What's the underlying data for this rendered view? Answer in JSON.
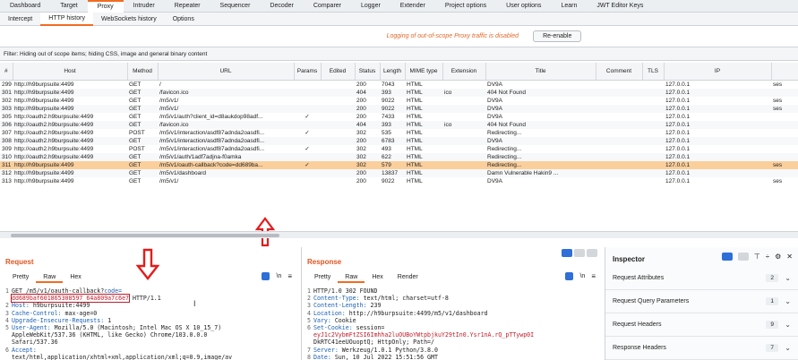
{
  "main_tabs": [
    "Dashboard",
    "Target",
    "Proxy",
    "Intruder",
    "Repeater",
    "Sequencer",
    "Decoder",
    "Comparer",
    "Logger",
    "Extender",
    "Project options",
    "User options",
    "Learn",
    "JWT Editor Keys"
  ],
  "main_active": 2,
  "sub_tabs": [
    "Intercept",
    "HTTP history",
    "WebSockets history",
    "Options"
  ],
  "sub_active": 1,
  "log_message": "Logging of out-of-scope Proxy traffic is disabled",
  "reenable_label": "Re-enable",
  "filter_text": "Filter: Hiding out of scope items;  hiding CSS, image and general binary content",
  "columns": [
    "#",
    "Host",
    "Method",
    "URL",
    "Params",
    "Edited",
    "Status",
    "Length",
    "MIME type",
    "Extension",
    "Title",
    "Comment",
    "TLS",
    "IP",
    ""
  ],
  "rows": [
    [
      "299",
      "http://h9burpsuite:4499",
      "GET",
      "/",
      "",
      "",
      "200",
      "7043",
      "HTML",
      "",
      "DV9A",
      "",
      "",
      "127.0.0.1",
      "ses"
    ],
    [
      "301",
      "http://h9burpsuite:4499",
      "GET",
      "/favicon.ico",
      "",
      "",
      "404",
      "393",
      "HTML",
      "ico",
      "404 Not Found",
      "",
      "",
      "127.0.0.1",
      ""
    ],
    [
      "302",
      "http://h9burpsuite:4499",
      "GET",
      "/m5/v1/",
      "",
      "",
      "200",
      "9022",
      "HTML",
      "",
      "DV9A",
      "",
      "",
      "127.0.0.1",
      "ses"
    ],
    [
      "303",
      "http://h9burpsuite:4499",
      "GET",
      "/m5/v1/",
      "",
      "",
      "200",
      "9022",
      "HTML",
      "",
      "DV9A",
      "",
      "",
      "127.0.0.1",
      "ses"
    ],
    [
      "305",
      "http://oauth2.h9burpsuite:4499",
      "GET",
      "/m5/v1/auth?client_id=d8aukdop98adf...",
      "✓",
      "",
      "200",
      "7433",
      "HTML",
      "",
      "DV9A",
      "",
      "",
      "127.0.0.1",
      ""
    ],
    [
      "306",
      "http://oauth2.h9burpsuite:4499",
      "GET",
      "/favicon.ico",
      "",
      "",
      "404",
      "393",
      "HTML",
      "ico",
      "404 Not Found",
      "",
      "",
      "127.0.0.1",
      ""
    ],
    [
      "307",
      "http://oauth2.h9burpsuite:4499",
      "POST",
      "/m5/v1/interaction/asdf87adnda2oasdfi...",
      "✓",
      "",
      "302",
      "535",
      "HTML",
      "",
      "Redirecting...",
      "",
      "",
      "127.0.0.1",
      ""
    ],
    [
      "308",
      "http://oauth2.h9burpsuite:4499",
      "GET",
      "/m5/v1/interaction/asdf87adnda2oasdfi...",
      "",
      "",
      "200",
      "6783",
      "HTML",
      "",
      "DV9A",
      "",
      "",
      "127.0.0.1",
      ""
    ],
    [
      "309",
      "http://oauth2.h9burpsuite:4499",
      "POST",
      "/m5/v1/interaction/asdf87adnda2oasdfi...",
      "✓",
      "",
      "302",
      "493",
      "HTML",
      "",
      "Redirecting...",
      "",
      "",
      "127.0.0.1",
      ""
    ],
    [
      "310",
      "http://oauth2.h9burpsuite:4499",
      "GET",
      "/m5/v1/auth/1adf7adjna-f0amka",
      "",
      "",
      "302",
      "622",
      "HTML",
      "",
      "Redirecting...",
      "",
      "",
      "127.0.0.1",
      ""
    ],
    [
      "311",
      "http://h9burpsuite:4499",
      "GET",
      "/m5/v1/oauth-callback?code=dd689ba...",
      "✓",
      "",
      "302",
      "579",
      "HTML",
      "",
      "Redirecting...",
      "",
      "",
      "127.0.0.1",
      "ses"
    ],
    [
      "312",
      "http://h9burpsuite:4499",
      "GET",
      "/m5/v1/dashboard",
      "",
      "",
      "200",
      "13837",
      "HTML",
      "",
      "Damn Vulnerable Hakin9 ...",
      "",
      "",
      "127.0.0.1",
      ""
    ],
    [
      "313",
      "http://h9burpsuite:4499",
      "GET",
      "/m5/v1/",
      "",
      "",
      "200",
      "9022",
      "HTML",
      "",
      "DV9A",
      "",
      "",
      "127.0.0.1",
      "ses"
    ]
  ],
  "selected_row": 10,
  "request": {
    "title": "Request",
    "tabs": [
      "Pretty",
      "Raw",
      "Hex"
    ],
    "active_tab": 1,
    "lines": [
      {
        "n": "1",
        "parts": [
          [
            "GET /m5/v1/oauth-callback?",
            ""
          ],
          [
            "code=",
            "kw"
          ]
        ]
      },
      {
        "n": "",
        "parts": [
          [
            "dd689baf601865308597 64a809a7c6e7",
            "hl"
          ],
          [
            " HTTP/1.1",
            ""
          ]
        ]
      },
      {
        "n": "2",
        "parts": [
          [
            "Host: ",
            "kw"
          ],
          [
            "h9burpsuite:4499",
            ""
          ]
        ]
      },
      {
        "n": "3",
        "parts": [
          [
            "Cache-Control: ",
            "kw"
          ],
          [
            "max-age=0",
            ""
          ]
        ]
      },
      {
        "n": "4",
        "parts": [
          [
            "Upgrade-Insecure-Requests: ",
            "kw"
          ],
          [
            "1",
            ""
          ]
        ]
      },
      {
        "n": "5",
        "parts": [
          [
            "User-Agent: ",
            "kw"
          ],
          [
            "Mozilla/5.0 (Macintosh; Intel Mac OS X 10_15_7)",
            ""
          ]
        ]
      },
      {
        "n": "",
        "parts": [
          [
            "AppleWebKit/537.36 (KHTML, like Gecko) Chrome/103.0.0.0",
            ""
          ]
        ]
      },
      {
        "n": "",
        "parts": [
          [
            "Safari/537.36",
            ""
          ]
        ]
      },
      {
        "n": "6",
        "parts": [
          [
            "Accept: ",
            "kw"
          ]
        ]
      },
      {
        "n": "",
        "parts": [
          [
            "text/html,application/xhtml+xml,application/xml;q=0.9,image/av",
            ""
          ]
        ]
      },
      {
        "n": "",
        "parts": [
          [
            "if,image/webp,image/apng,*/*;q=0.8,application/signed-exchange",
            ""
          ]
        ]
      }
    ]
  },
  "response": {
    "title": "Response",
    "tabs": [
      "Pretty",
      "Raw",
      "Hex",
      "Render"
    ],
    "active_tab": 1,
    "lines": [
      {
        "n": "1",
        "parts": [
          [
            "HTTP/1.0 302 FOUND",
            ""
          ]
        ]
      },
      {
        "n": "2",
        "parts": [
          [
            "Content-Type: ",
            "kw"
          ],
          [
            "text/html; charset=utf-8",
            ""
          ]
        ]
      },
      {
        "n": "3",
        "parts": [
          [
            "Content-Length: ",
            "kw"
          ],
          [
            "239",
            ""
          ]
        ]
      },
      {
        "n": "4",
        "parts": [
          [
            "Location: ",
            "kw"
          ],
          [
            "http://h9burpsuite:4499/m5/v1/dashboard",
            ""
          ]
        ]
      },
      {
        "n": "5",
        "parts": [
          [
            "Vary: ",
            "kw"
          ],
          [
            "Cookie",
            ""
          ]
        ]
      },
      {
        "n": "6",
        "parts": [
          [
            "Set-Cookie: ",
            "kw"
          ],
          [
            "session=",
            ""
          ]
        ]
      },
      {
        "n": "",
        "parts": [
          [
            "eyJ1c2VybmFtZSI6Imhha2luOUBoYWtpbjkuY29tIn0.Ysr1nA.rQ_pTTywp0I",
            "red"
          ]
        ]
      },
      {
        "n": "",
        "parts": [
          [
            "DkRTC41eeUOuoptQ",
            ""
          ],
          [
            "; HttpOnly; Path=/",
            ""
          ]
        ]
      },
      {
        "n": "7",
        "parts": [
          [
            "Server: ",
            "kw"
          ],
          [
            "Werkzeug/1.0.1 Python/3.8.0",
            ""
          ]
        ]
      },
      {
        "n": "8",
        "parts": [
          [
            "Date: ",
            "kw"
          ],
          [
            "Sun, 10 Jul 2022 15:51:56 GMT",
            ""
          ]
        ]
      }
    ]
  },
  "inspector": {
    "title": "Inspector",
    "sections": [
      {
        "label": "Request Attributes",
        "count": "2"
      },
      {
        "label": "Request Query Parameters",
        "count": "1"
      },
      {
        "label": "Request Headers",
        "count": "9"
      },
      {
        "label": "Response Headers",
        "count": "7"
      }
    ]
  },
  "colors": {
    "accent": "#f26b21",
    "selected_row": "#fbcf9c",
    "annotation": "#e31c1c"
  }
}
